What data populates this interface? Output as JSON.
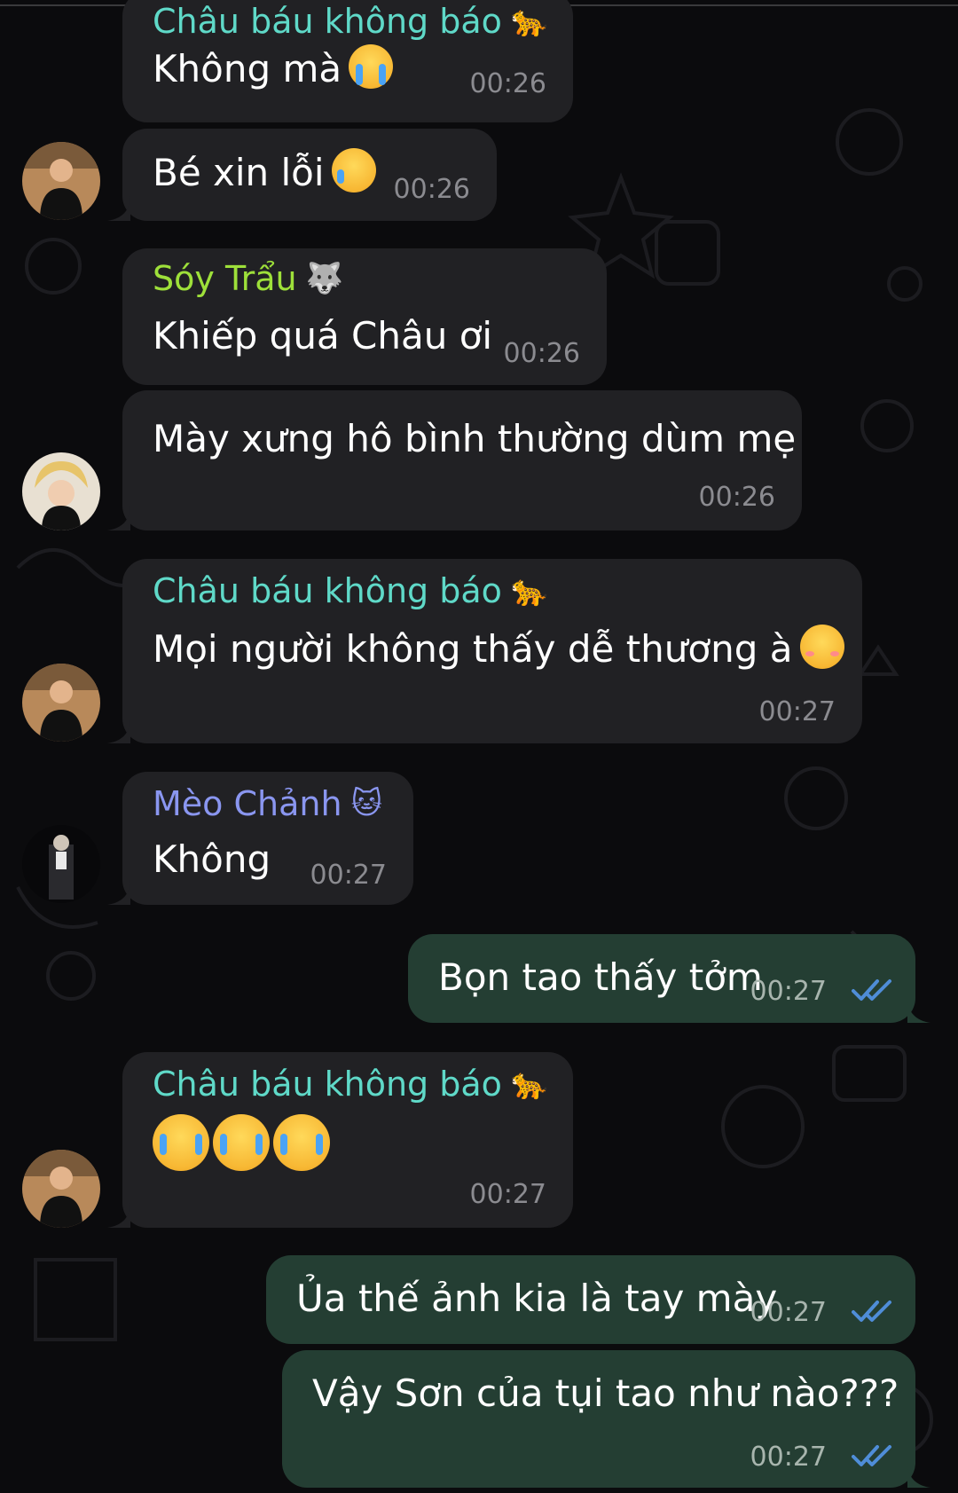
{
  "colors": {
    "background": "#0b0b0d",
    "incoming_bubble": "#212124",
    "outgoing_bubble": "#243e33",
    "timestamp": "#8b8b90",
    "read_ticks": "#4f8dd8",
    "sender_chau": "#5fd9c8",
    "sender_soy": "#9ee03a",
    "sender_meo": "#8a96f0"
  },
  "senders": {
    "chau": {
      "name": "Châu báu không báo",
      "emoji": "leopard-icon"
    },
    "soy": {
      "name": "Sóy Trẩu",
      "emoji": "wolf-icon"
    },
    "meo": {
      "name": "Mèo Chảnh",
      "emoji": "cat-icon"
    }
  },
  "messages": [
    {
      "id": "m1",
      "direction": "in",
      "sender": "Châu báu không báo",
      "text": "Không mà",
      "emoji": "loudly-crying-icon",
      "time": "00:26"
    },
    {
      "id": "m2",
      "direction": "in",
      "sender": "",
      "text": "Bé xin lỗi",
      "emoji": "crying-face-icon",
      "time": "00:26"
    },
    {
      "id": "m3",
      "direction": "in",
      "sender": "Sóy Trẩu",
      "text": "Khiếp quá Châu ơi",
      "time": "00:26"
    },
    {
      "id": "m4",
      "direction": "in",
      "sender": "",
      "text": "Mày xưng hô bình thường dùm mẹ",
      "time": "00:26"
    },
    {
      "id": "m5",
      "direction": "in",
      "sender": "Châu báu không báo",
      "text": "Mọi người không thấy dễ thương à",
      "emoji": "smiling-face-icon",
      "time": "00:27"
    },
    {
      "id": "m6",
      "direction": "in",
      "sender": "Mèo Chảnh",
      "text": "Không",
      "time": "00:27"
    },
    {
      "id": "m7",
      "direction": "out",
      "text": "Bọn tao thấy tởm",
      "time": "00:27",
      "status": "read"
    },
    {
      "id": "m8",
      "direction": "in",
      "sender": "Châu báu không báo",
      "text": "",
      "emoji": "loudly-crying-icon x3",
      "time": "00:27"
    },
    {
      "id": "m9",
      "direction": "out",
      "text": "Ủa thế ảnh kia là tay mày",
      "time": "00:27",
      "status": "read"
    },
    {
      "id": "m10",
      "direction": "out",
      "text": "Vậy Sơn của tụi tao như nào???",
      "time": "00:27",
      "status": "read"
    }
  ]
}
